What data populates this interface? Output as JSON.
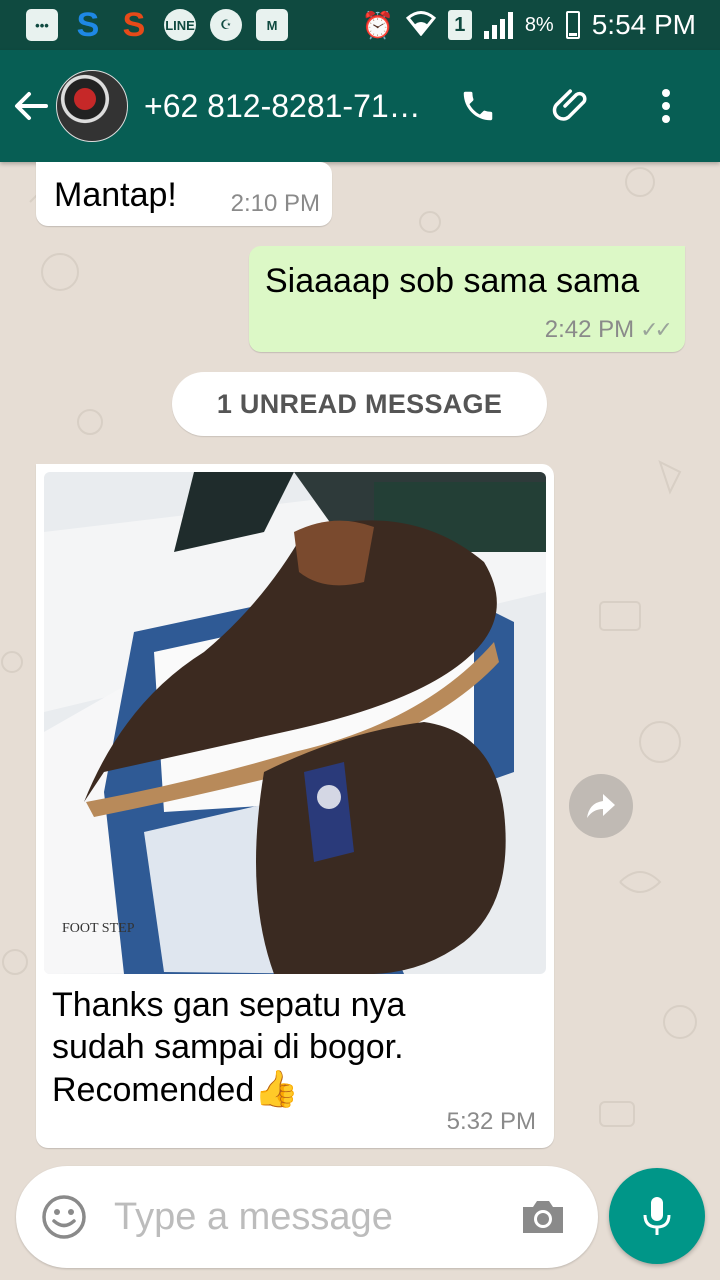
{
  "status_bar": {
    "line_label": "LINE",
    "sim_label": "1",
    "battery": "8%",
    "time": "5:54 PM"
  },
  "header": {
    "contact_name": "+62 812-8281-71…"
  },
  "messages": [
    {
      "direction": "in",
      "text": "Mantap!",
      "time": "2:10 PM"
    },
    {
      "direction": "out",
      "text": "Siaaaap sob sama sama",
      "time": "2:42 PM",
      "status": "read"
    },
    {
      "direction": "in",
      "type": "image",
      "caption_lines": [
        "Thanks gan sepatu nya",
        "sudah sampai di bogor.",
        "Recomended"
      ],
      "emoji": "👍",
      "time": "5:32 PM"
    }
  ],
  "unread_divider": "1 UNREAD MESSAGE",
  "composer": {
    "placeholder": "Type a message"
  },
  "colors": {
    "status_bar": "#0f4a40",
    "app_bar": "#075e54",
    "outgoing_bubble": "#dcf8c6",
    "incoming_bubble": "#ffffff",
    "mic_button": "#009688"
  },
  "icons": [
    "back-arrow-icon",
    "phone-icon",
    "paperclip-icon",
    "more-vert-icon",
    "emoji-icon",
    "camera-icon",
    "mic-icon",
    "forward-icon"
  ]
}
